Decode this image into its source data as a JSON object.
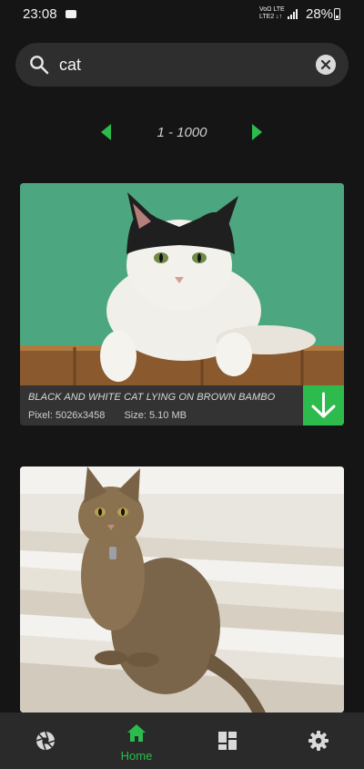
{
  "status_bar": {
    "time": "23:08",
    "network_text": "VoΩ LTE\nLTE2 ↓↑",
    "battery": "28%"
  },
  "search": {
    "query": "cat",
    "icon": "search-icon",
    "clear_icon": "close-icon"
  },
  "pager": {
    "range": "1 - 1000",
    "prev_icon": "chevron-left-icon",
    "next_icon": "chevron-right-icon"
  },
  "results": [
    {
      "title": "BLACK AND WHITE CAT LYING ON BROWN BAMBO",
      "pixel_label": "Pixel: 5026x3458",
      "size_label": "Size: 5.10 MB",
      "action_icon": "download-icon"
    },
    {
      "photo": "tabby-cat-sitting-on-stairs"
    }
  ],
  "bottom_nav": {
    "items": [
      {
        "icon": "aperture-icon",
        "label": ""
      },
      {
        "icon": "home-icon",
        "label": "Home",
        "active": true
      },
      {
        "icon": "dashboard-icon",
        "label": ""
      },
      {
        "icon": "gear-icon",
        "label": ""
      }
    ]
  },
  "colors": {
    "accent": "#2dbb4e",
    "background": "#151515",
    "surface": "#2e2e2e"
  }
}
